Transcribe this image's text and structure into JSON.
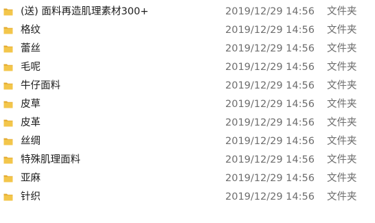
{
  "files": [
    {
      "name": "(送) 面料再造肌理素材300+",
      "date_modified": "2019/12/29 14:56",
      "type": "文件夹",
      "icon": "folder-icon"
    },
    {
      "name": "格纹",
      "date_modified": "2019/12/29 14:56",
      "type": "文件夹",
      "icon": "folder-icon"
    },
    {
      "name": "蕾丝",
      "date_modified": "2019/12/29 14:56",
      "type": "文件夹",
      "icon": "folder-icon"
    },
    {
      "name": "毛呢",
      "date_modified": "2019/12/29 14:56",
      "type": "文件夹",
      "icon": "folder-icon"
    },
    {
      "name": "牛仔面料",
      "date_modified": "2019/12/29 14:56",
      "type": "文件夹",
      "icon": "folder-icon"
    },
    {
      "name": "皮草",
      "date_modified": "2019/12/29 14:56",
      "type": "文件夹",
      "icon": "folder-icon"
    },
    {
      "name": "皮革",
      "date_modified": "2019/12/29 14:56",
      "type": "文件夹",
      "icon": "folder-icon"
    },
    {
      "name": "丝绸",
      "date_modified": "2019/12/29 14:56",
      "type": "文件夹",
      "icon": "folder-icon"
    },
    {
      "name": "特殊肌理面料",
      "date_modified": "2019/12/29 14:56",
      "type": "文件夹",
      "icon": "folder-icon"
    },
    {
      "name": "亚麻",
      "date_modified": "2019/12/29 14:56",
      "type": "文件夹",
      "icon": "folder-icon"
    },
    {
      "name": "针织",
      "date_modified": "2019/12/29 14:56",
      "type": "文件夹",
      "icon": "folder-icon"
    }
  ],
  "colors": {
    "folder_front": "#f3c64b",
    "folder_back": "#e2a82c",
    "text": "#1b1b1b",
    "secondary_text": "#6d6d6d"
  }
}
